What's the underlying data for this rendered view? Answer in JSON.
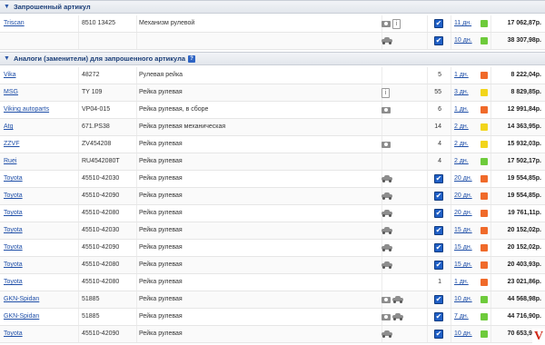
{
  "requested": {
    "title": "Запрошенный артикул",
    "rows": [
      {
        "brand": "Triscan",
        "article": "8510 13425",
        "desc": "Механизм рулевой",
        "icons": [
          "camera",
          "info"
        ],
        "qty": "",
        "days": "11 дн.",
        "stock": "green",
        "price": "17 062,87р."
      },
      {
        "brand": "",
        "article": "",
        "desc": "",
        "icons": [
          "car"
        ],
        "qty": "",
        "days": "10 дн.",
        "stock": "green",
        "price": "38 307,98р."
      }
    ]
  },
  "analogs": {
    "title": "Аналоги (заменители) для запрошенного артикула",
    "help_icon": "?",
    "rows": [
      {
        "brand": "Vika",
        "article": "48272",
        "desc": "Рулевая рейка",
        "icons": [],
        "qty": "5",
        "check": false,
        "days": "1 дн.",
        "stock": "orange",
        "price": "8 222,04р."
      },
      {
        "brand": "MSG",
        "article": "TY 109",
        "desc": "Рейка рулевая",
        "icons": [
          "info"
        ],
        "qty": "55",
        "check": false,
        "days": "3 дн.",
        "stock": "yellow",
        "price": "8 829,85р."
      },
      {
        "brand": "Viking autoparts",
        "article": "VP04-015",
        "desc": "Рейка рулевая, в сборе",
        "icons": [
          "camera"
        ],
        "qty": "6",
        "check": false,
        "days": "1 дн.",
        "stock": "orange",
        "price": "12 991,84р."
      },
      {
        "brand": "Atg",
        "article": "671.PS38",
        "desc": "Рейка рулевая механическая",
        "icons": [],
        "qty": "14",
        "check": false,
        "days": "2 дн.",
        "stock": "yellow",
        "price": "14 363,95р."
      },
      {
        "brand": "ZZVF",
        "article": "ZV454208",
        "desc": "Рейка рулевая",
        "icons": [
          "camera"
        ],
        "qty": "4",
        "check": false,
        "days": "2 дн.",
        "stock": "yellow",
        "price": "15 932,03р."
      },
      {
        "brand": "Ruei",
        "article": "RU4542080T",
        "desc": "Рейка рулевая",
        "icons": [],
        "qty": "4",
        "check": false,
        "days": "2 дн.",
        "stock": "green",
        "price": "17 502,17р."
      },
      {
        "brand": "Toyota",
        "article": "45510-42030",
        "desc": "Рейка рулевая",
        "icons": [
          "car"
        ],
        "qty": "",
        "check": true,
        "days": "20 дн.",
        "stock": "orange",
        "price": "19 554,85р."
      },
      {
        "brand": "Toyota",
        "article": "45510-42090",
        "desc": "Рейка рулевая",
        "icons": [
          "car"
        ],
        "qty": "",
        "check": true,
        "days": "20 дн.",
        "stock": "orange",
        "price": "19 554,85р."
      },
      {
        "brand": "Toyota",
        "article": "45510-42080",
        "desc": "Рейка рулевая",
        "icons": [
          "car"
        ],
        "qty": "",
        "check": true,
        "days": "20 дн.",
        "stock": "orange",
        "price": "19 761,11р."
      },
      {
        "brand": "Toyota",
        "article": "45510-42030",
        "desc": "Рейка рулевая",
        "icons": [
          "car"
        ],
        "qty": "",
        "check": true,
        "days": "15 дн.",
        "stock": "orange",
        "price": "20 152,02р."
      },
      {
        "brand": "Toyota",
        "article": "45510-42090",
        "desc": "Рейка рулевая",
        "icons": [
          "car"
        ],
        "qty": "",
        "check": true,
        "days": "15 дн.",
        "stock": "orange",
        "price": "20 152,02р."
      },
      {
        "brand": "Toyota",
        "article": "45510-42080",
        "desc": "Рейка рулевая",
        "icons": [
          "car"
        ],
        "qty": "",
        "check": true,
        "days": "15 дн.",
        "stock": "orange",
        "price": "20 403,93р."
      },
      {
        "brand": "Toyota",
        "article": "45510-42080",
        "desc": "Рейка рулевая",
        "icons": [],
        "qty": "1",
        "check": false,
        "days": "1 дн.",
        "stock": "orange",
        "price": "23 021,86р."
      },
      {
        "brand": "GKN-Spidan",
        "article": "51885",
        "desc": "Рейка рулевая",
        "icons": [
          "camera",
          "car"
        ],
        "qty": "",
        "check": true,
        "days": "10 дн.",
        "stock": "green",
        "price": "44 568,98р."
      },
      {
        "brand": "GKN-Spidan",
        "article": "51885",
        "desc": "Рейка рулевая",
        "icons": [
          "camera",
          "car"
        ],
        "qty": "",
        "check": true,
        "days": "7 дн.",
        "stock": "green",
        "price": "44 716,90р."
      },
      {
        "brand": "Toyota",
        "article": "45510-42090",
        "desc": "Рейка рулевая",
        "icons": [
          "car"
        ],
        "qty": "",
        "check": true,
        "days": "10 дн.",
        "stock": "green",
        "price": "70 653,90р."
      }
    ]
  },
  "colors": {
    "green": "#6ecb3b",
    "orange": "#f06a2a",
    "yellow": "#f2d51b",
    "link": "#1f4fa8",
    "header": "#1c3f79"
  },
  "watermark": "V"
}
